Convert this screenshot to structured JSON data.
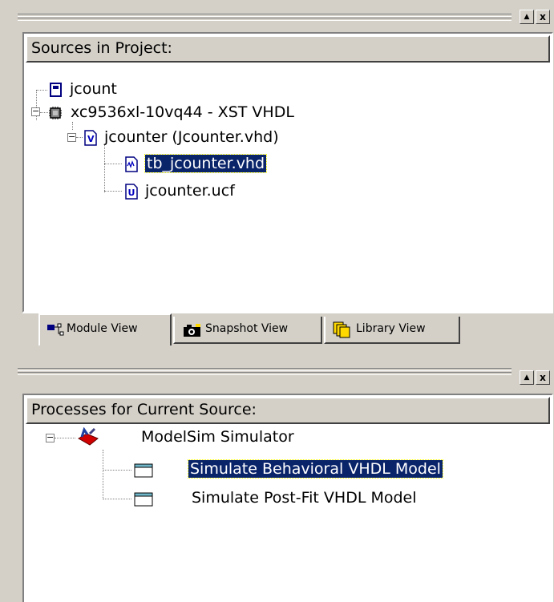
{
  "sources_panel": {
    "header": "Sources in Project:",
    "tree": [
      {
        "label": "jcount",
        "icon": "project-icon"
      },
      {
        "label": "xc9536xl-10vq44 - XST VHDL",
        "icon": "chip-icon"
      },
      {
        "label": "jcounter (Jcounter.vhd)",
        "icon": "vhdl-file-icon"
      },
      {
        "label": "tb_jcounter.vhd",
        "icon": "testbench-file-icon",
        "selected": true
      },
      {
        "label": "jcounter.ucf",
        "icon": "constraint-file-icon"
      }
    ],
    "tabs": [
      {
        "label": "Module View",
        "icon": "module-view-icon",
        "active": true
      },
      {
        "label": "Snapshot View",
        "icon": "camera-icon"
      },
      {
        "label": "Library View",
        "icon": "library-icon"
      }
    ]
  },
  "processes_panel": {
    "header": "Processes for Current Source:",
    "tree": [
      {
        "label": "ModelSim Simulator",
        "icon": "simulator-icon"
      },
      {
        "label": "Simulate Behavioral VHDL Model",
        "icon": "process-icon",
        "selected": true
      },
      {
        "label": "Simulate Post-Fit VHDL Model",
        "icon": "process-icon"
      }
    ]
  },
  "window_controls": {
    "restore": "▲",
    "close": "x"
  }
}
